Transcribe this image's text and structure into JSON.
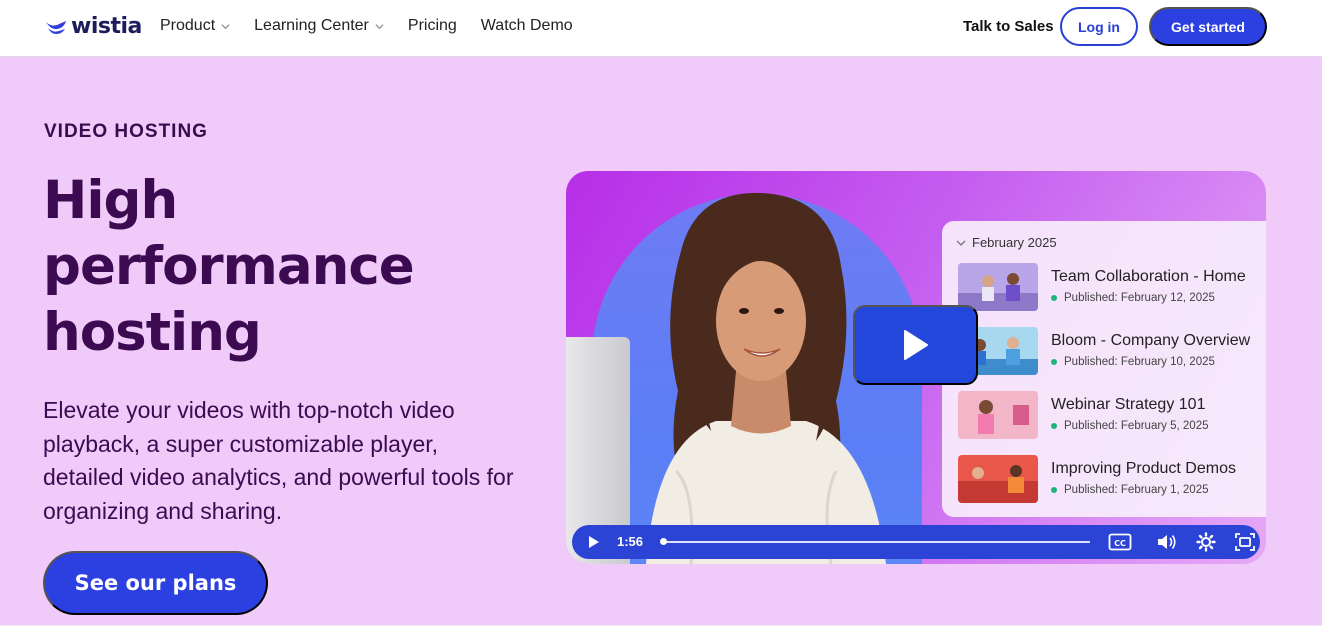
{
  "brand": {
    "name": "wistia"
  },
  "nav": {
    "links": [
      {
        "label": "Product",
        "has_dropdown": true
      },
      {
        "label": "Learning Center",
        "has_dropdown": true
      },
      {
        "label": "Pricing",
        "has_dropdown": false
      },
      {
        "label": "Watch Demo",
        "has_dropdown": false
      }
    ],
    "talk_to_sales": "Talk to Sales",
    "login": "Log in",
    "get_started": "Get started"
  },
  "hero": {
    "eyebrow": "VIDEO HOSTING",
    "headline": [
      "High",
      "performance",
      "hosting"
    ],
    "subtext": "Elevate your videos with top-notch video playback, a super customizable player, detailed video analytics, and powerful tools for organizing and sharing.",
    "cta": "See our plans"
  },
  "player": {
    "playlist_month": "February 2025",
    "items": [
      {
        "title": "Team Collaboration - Home",
        "published": "Published: February 12, 2025"
      },
      {
        "title": "Bloom - Company Overview",
        "published": "Published: February 10, 2025"
      },
      {
        "title": "Webinar Strategy 101",
        "published": "Published: February 5, 2025"
      },
      {
        "title": "Improving Product Demos",
        "published": "Published: February 1, 2025"
      }
    ],
    "time": "1:56",
    "progress": 0.0,
    "icons": [
      "play-icon",
      "captions-icon",
      "volume-icon",
      "settings-icon",
      "fullscreen-icon"
    ]
  },
  "colors": {
    "accent": "#2c3fe0",
    "hero_bg": "#f0caf9",
    "text_dark": "#3b0a50",
    "published_dot": "#1db57b"
  }
}
